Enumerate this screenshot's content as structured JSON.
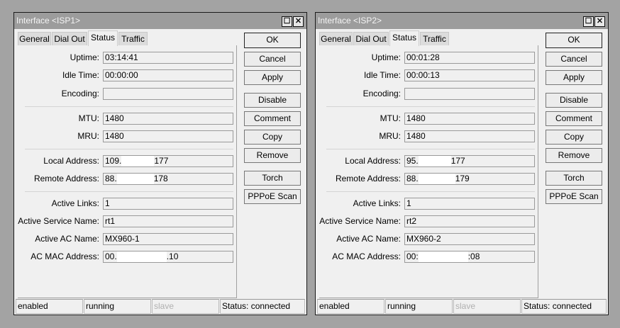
{
  "windows": [
    {
      "title": "Interface <ISP1>",
      "tabs": [
        "General",
        "Dial Out",
        "Status",
        "Traffic"
      ],
      "selected_tab": 2,
      "fields": [
        {
          "label": "Uptime:",
          "value": "03:14:41"
        },
        {
          "label": "Idle Time:",
          "value": "00:00:00"
        },
        {
          "label": "Encoding:",
          "value": ""
        },
        {
          "label": "MTU:",
          "value": "1480"
        },
        {
          "label": "MRU:",
          "value": "1480"
        },
        {
          "label": "Local Address:",
          "value": "109.",
          "redacted_suffix": "177"
        },
        {
          "label": "Remote Address:",
          "value": "88.",
          "redacted_suffix": "178"
        },
        {
          "label": "Active Links:",
          "value": "1"
        },
        {
          "label": "Active Service Name:",
          "value": "rt1"
        },
        {
          "label": "Active AC Name:",
          "value": "MX960-1"
        },
        {
          "label": "AC MAC Address:",
          "value": "00.",
          "redacted_suffix": ".10"
        }
      ],
      "buttons": [
        "OK",
        "Cancel",
        "Apply",
        "Disable",
        "Comment",
        "Copy",
        "Remove",
        "Torch",
        "PPPoE Scan"
      ],
      "status": [
        "enabled",
        "running",
        "slave",
        "Status: connected"
      ]
    },
    {
      "title": "Interface <ISP2>",
      "tabs": [
        "General",
        "Dial Out",
        "Status",
        "Traffic"
      ],
      "selected_tab": 2,
      "fields": [
        {
          "label": "Uptime:",
          "value": "00:01:28"
        },
        {
          "label": "Idle Time:",
          "value": "00:00:13"
        },
        {
          "label": "Encoding:",
          "value": ""
        },
        {
          "label": "MTU:",
          "value": "1480"
        },
        {
          "label": "MRU:",
          "value": "1480"
        },
        {
          "label": "Local Address:",
          "value": "95.",
          "redacted_suffix": "177"
        },
        {
          "label": "Remote Address:",
          "value": "88.",
          "redacted_suffix": "179"
        },
        {
          "label": "Active Links:",
          "value": "1"
        },
        {
          "label": "Active Service Name:",
          "value": "rt2"
        },
        {
          "label": "Active AC Name:",
          "value": "MX960-2"
        },
        {
          "label": "AC MAC Address:",
          "value": "00:",
          "redacted_suffix": ":08"
        }
      ],
      "buttons": [
        "OK",
        "Cancel",
        "Apply",
        "Disable",
        "Comment",
        "Copy",
        "Remove",
        "Torch",
        "PPPoE Scan"
      ],
      "status": [
        "enabled",
        "running",
        "slave",
        "Status: connected"
      ]
    }
  ]
}
